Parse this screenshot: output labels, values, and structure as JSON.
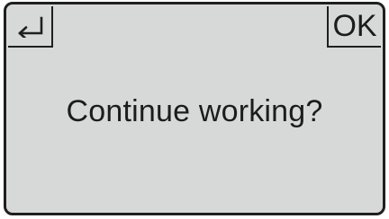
{
  "dialog": {
    "message": "Continue working?",
    "back_icon": "back-return-icon",
    "ok_label": "OK"
  },
  "colors": {
    "screen_background": "#d7d9d8",
    "border": "#1f1f1f",
    "text": "#1c1c1c"
  }
}
